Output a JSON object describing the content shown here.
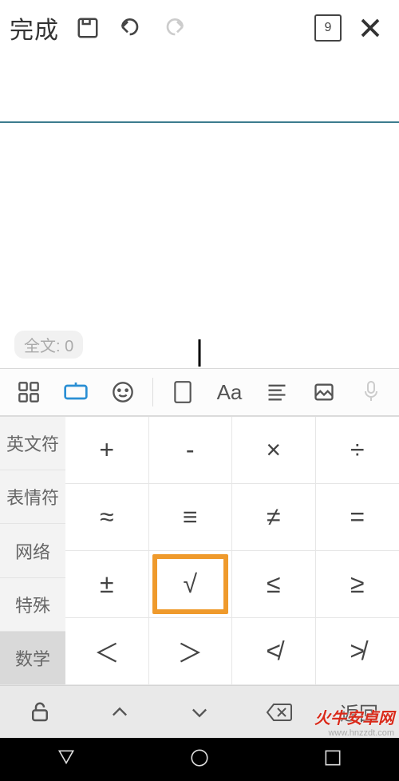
{
  "topbar": {
    "done_label": "完成",
    "page_number": "9"
  },
  "editor": {
    "wordcount_prefix": "全文: ",
    "wordcount": "0"
  },
  "fmtbar": {
    "Aa": "Aa"
  },
  "categories": {
    "items": [
      {
        "label": "英文符",
        "active": false
      },
      {
        "label": "表情符",
        "active": false
      },
      {
        "label": "网络",
        "active": false
      },
      {
        "label": "特殊",
        "active": false
      },
      {
        "label": "数学",
        "active": true
      }
    ]
  },
  "symbols": {
    "rows": [
      [
        "+",
        "-",
        "×",
        "÷"
      ],
      [
        "≈",
        "≡",
        "≠",
        "="
      ],
      [
        "±",
        "√",
        "≤",
        "≥"
      ],
      [
        "＜",
        "＞",
        "≮",
        "≯"
      ]
    ],
    "highlighted": "√"
  },
  "kctrl": {
    "return_label": "返回"
  },
  "watermark": {
    "line1": "火牛安卓网",
    "line2": "www.hnzzdt.com"
  }
}
